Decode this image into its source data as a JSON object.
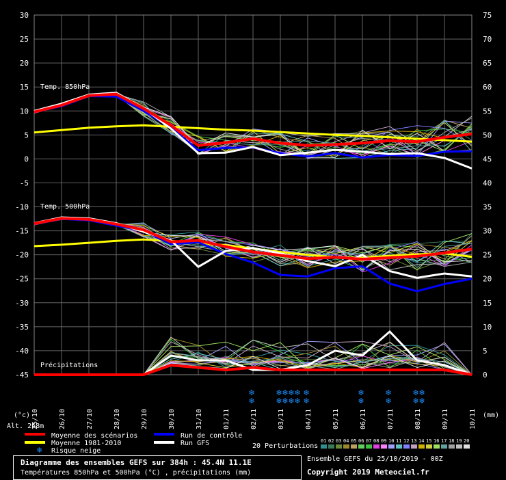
{
  "chart_data": {
    "type": "line",
    "left_ticks": [
      "30",
      "25",
      "20",
      "15",
      "10",
      "5",
      "0",
      "-5",
      "-10",
      "-15",
      "-20",
      "-25",
      "-30",
      "-35",
      "-40",
      "-45"
    ],
    "right_ticks": [
      "75",
      "70",
      "65",
      "60",
      "55",
      "50",
      "45",
      "40",
      "35",
      "30",
      "25",
      "20",
      "15",
      "10",
      "5",
      "0"
    ],
    "ylim_left": [
      -45,
      30
    ],
    "ylim_right": [
      0,
      75
    ],
    "x_labels": [
      "25/10",
      "26/10",
      "27/10",
      "28/10",
      "29/10",
      "30/10",
      "31/10",
      "01/11",
      "02/11",
      "03/11",
      "04/11",
      "05/11",
      "06/11",
      "07/11",
      "08/11",
      "09/11",
      "10/11"
    ],
    "panel_labels": {
      "t850": "Temp. 850hPa",
      "t500": "Temp. 500hPa",
      "precip": "Précipitations"
    },
    "unit_left": "(°c)",
    "unit_right": "(mm)",
    "altitude": "Alt. 268m",
    "colors": {
      "mean": "#ff0000",
      "clim": "#ffff00",
      "control": "#0000ff",
      "gfs": "#ffffff",
      "grid": "#666666",
      "snow": "#1e90ff"
    },
    "series": [
      {
        "name": "Moyenne des scénarios",
        "t850": [
          9.8,
          11.2,
          13.2,
          13.5,
          10.5,
          7.0,
          2.8,
          3.4,
          4.2,
          3.3,
          2.8,
          3.0,
          3.3,
          3.8,
          3.6,
          4.5,
          5.2
        ],
        "t500": [
          -13.5,
          -12.4,
          -12.6,
          -13.6,
          -14.8,
          -17.3,
          -17.0,
          -18.3,
          -19.4,
          -20.1,
          -20.8,
          -20.5,
          -20.9,
          -20.6,
          -20.3,
          -19.6,
          -18.8
        ],
        "precip": [
          0,
          0,
          0,
          0,
          0,
          2,
          1.5,
          1,
          1.5,
          1,
          1,
          1,
          1,
          1,
          1,
          1,
          0
        ]
      },
      {
        "name": "Moyenne 1981-2010",
        "t850": [
          5.5,
          6.0,
          6.5,
          6.8,
          7.0,
          6.7,
          6.4,
          6.1,
          5.9,
          5.6,
          5.3,
          5.0,
          4.8,
          4.5,
          4.2,
          3.9,
          3.6
        ],
        "t500": [
          -18.2,
          -17.9,
          -17.5,
          -17.1,
          -16.8,
          -17.1,
          -17.5,
          -18.0,
          -18.7,
          -19.4,
          -20.0,
          -20.5,
          -20.6,
          -20.2,
          -19.9,
          -19.7,
          -20.4
        ]
      },
      {
        "name": "Run de contrôle",
        "t850": [
          9.8,
          11.0,
          13.1,
          13.0,
          10.0,
          6.5,
          1.8,
          2.3,
          2.4,
          1.2,
          0.5,
          1.2,
          0.3,
          0.8,
          0.6,
          1.5,
          1.6
        ],
        "t500": [
          -13.6,
          -12.5,
          -12.8,
          -13.9,
          -15.0,
          -17.8,
          -17.4,
          -19.8,
          -21.6,
          -24.2,
          -24.5,
          -22.8,
          -22.4,
          -26.0,
          -27.6,
          -26.1,
          -25.0
        ]
      },
      {
        "name": "Run GFS",
        "t850": [
          10.0,
          11.5,
          13.4,
          13.8,
          10.6,
          6.3,
          1.2,
          1.3,
          2.5,
          0.8,
          1.3,
          1.9,
          1.5,
          1.0,
          1.2,
          0.2,
          -2.0
        ],
        "t500": [
          -13.4,
          -12.2,
          -12.4,
          -13.4,
          -15.2,
          -17.0,
          -22.5,
          -19.2,
          -18.6,
          -19.7,
          -21.3,
          -22.4,
          -20.0,
          -23.4,
          -24.8,
          -23.9,
          -24.5
        ],
        "precip": [
          0,
          0,
          0,
          0,
          0,
          4,
          3,
          3,
          1,
          1,
          2,
          5,
          4,
          9,
          3,
          2,
          0
        ]
      }
    ],
    "snow_risk_x": [
      "02/11",
      "03/11",
      "03/11",
      "03/11",
      "03/11",
      "04/11",
      "06/11",
      "07/11",
      "08/11",
      "08/11"
    ]
  },
  "legend": {
    "mean": "Moyenne des scénarios",
    "clim": "Moyenne 1981-2010",
    "control": "Run de contrôle",
    "gfs": "Run GFS",
    "snow": "Risque neige",
    "perturbations": "20 Perturbations",
    "pert_numbers": [
      "01",
      "02",
      "03",
      "04",
      "05",
      "06",
      "07",
      "08",
      "09",
      "10",
      "11",
      "12",
      "13",
      "14",
      "15",
      "16",
      "17",
      "18",
      "19",
      "20"
    ],
    "pert_colors": [
      "#2f8f8f",
      "#3a7a5a",
      "#6a8a3a",
      "#9a8a2a",
      "#c0a060",
      "#5fcf5f",
      "#40c040",
      "#e040e0",
      "#ff80ff",
      "#a0a0ff",
      "#60c0c0",
      "#8080ff",
      "#c0a0c0",
      "#d0b000",
      "#d0d040",
      "#a0e060",
      "#60a0a0",
      "#a0a0a0",
      "#c0c0c0",
      "#e0e0e0"
    ]
  },
  "footer": {
    "title": "Diagramme des ensembles GEFS sur 384h : 45.4N 11.1E",
    "subtitle": "Températures 850hPa et 500hPa (°C) , précipitations (mm)",
    "run": "Ensemble GEFS du 25/10/2019 - 00Z",
    "copyright": "Copyright 2019 Meteociel.fr"
  }
}
